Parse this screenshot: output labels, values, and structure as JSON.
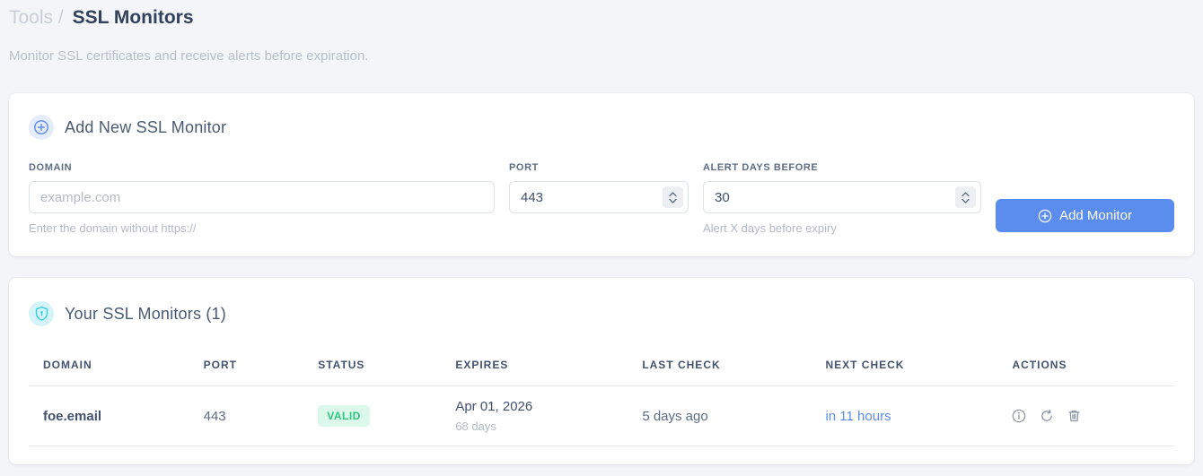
{
  "colors": {
    "accent_blue": "#5b8def",
    "shield_cyan": "#35cfe0",
    "valid_bg": "#dcf8ea",
    "valid_text": "#2bc77e",
    "page_bg": "#f4f5f8"
  },
  "header": {
    "breadcrumb_parent": "Tools",
    "breadcrumb_separator": "/",
    "breadcrumb_current": "SSL Monitors",
    "subtitle": "Monitor SSL certificates and receive alerts before expiration."
  },
  "add_monitor": {
    "title": "Add New SSL Monitor",
    "header_icon": "plus-circle-icon",
    "fields": {
      "domain": {
        "label": "DOMAIN",
        "placeholder": "example.com",
        "value": "",
        "helper": "Enter the domain without https://"
      },
      "port": {
        "label": "PORT",
        "value": "443"
      },
      "alert_days": {
        "label": "ALERT DAYS BEFORE",
        "value": "30",
        "helper": "Alert X days before expiry"
      }
    },
    "submit": {
      "label": "Add Monitor",
      "icon": "plus-circle-icon"
    }
  },
  "monitors": {
    "title": "Your SSL Monitors (1)",
    "count": 1,
    "header_icon": "shield-icon",
    "columns": {
      "domain": "DOMAIN",
      "port": "PORT",
      "status": "STATUS",
      "expires": "EXPIRES",
      "last_check": "LAST CHECK",
      "next_check": "NEXT CHECK",
      "actions": "ACTIONS"
    },
    "rows": [
      {
        "domain": "foe.email",
        "port": "443",
        "status": "VALID",
        "expires_date": "Apr 01, 2026",
        "expires_days": "68 days",
        "last_check": "5 days ago",
        "next_check": "in 11 hours",
        "action_icons": [
          "info-icon",
          "refresh-icon",
          "trash-icon"
        ]
      }
    ]
  }
}
